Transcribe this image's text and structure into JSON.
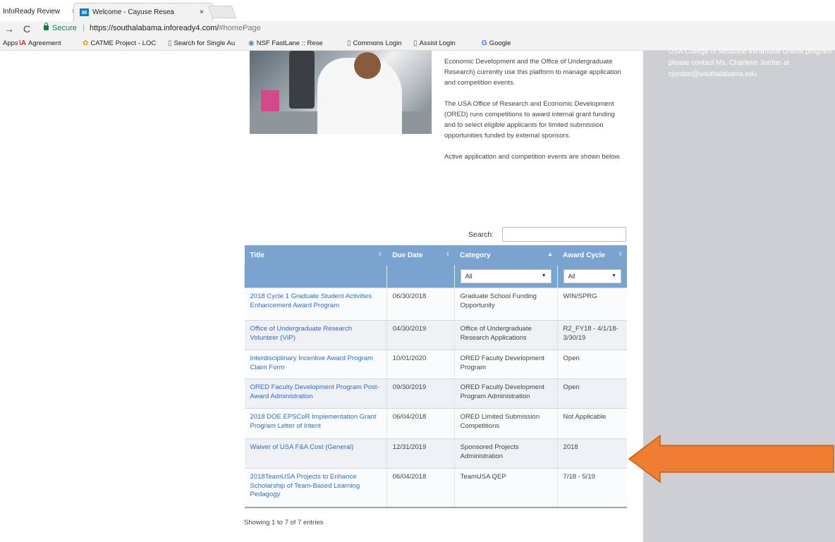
{
  "browser": {
    "tabs": [
      {
        "title": "InfoReady Review",
        "close": "×"
      },
      {
        "title": "Welcome - Cayuse Resea",
        "close": "×"
      }
    ],
    "back": "→",
    "reload": "C",
    "secure_label": "Secure",
    "separator": "|",
    "url": "https://southalabama.infoready4.com/",
    "url_hash": "#homePage",
    "bookmarks": [
      {
        "icon": "·",
        "label": "Apps"
      },
      {
        "icon": "\\A",
        "label": "Agreement"
      },
      {
        "icon": "✿",
        "label": "CATME Project - LOC"
      },
      {
        "icon": "▯",
        "label": "Search for Single Au"
      },
      {
        "icon": "◉",
        "label": "NSF FastLane :: Rese"
      },
      {
        "icon": "▯",
        "label": "Commons Login"
      },
      {
        "icon": "▯",
        "label": "Assist Login"
      },
      {
        "icon": "G",
        "label": "Google"
      }
    ]
  },
  "sidebar": {
    "text": "USA College of Medicine Intramural Grants program please contact Ms. Charlene Jordan at cjordan@southalabama.edu"
  },
  "intro": {
    "p1": "Economic Development and the Office of Undergraduate Research) currently use this platform to manage application and competition events.",
    "p2": "The USA Office of Research and Economic Development (ORED) runs competitions to award internal grant funding and to select eligible applicants for limited submission opportunities funded by external sponsors.",
    "p3": "Active application and competition events are shown below."
  },
  "search": {
    "label": "Search:",
    "value": ""
  },
  "table": {
    "headers": {
      "title": "Title",
      "due_date": "Due Date",
      "category": "Category",
      "award_cycle": "Award Cycle"
    },
    "filters": {
      "category": "All",
      "award_cycle": "All"
    },
    "rows": [
      {
        "title": "2018 Cycle 1 Graduate Student Activities Enhancement Award Program",
        "due": "06/30/2018",
        "category": "Graduate School Funding Opportunity",
        "award": "WIN/SPRG"
      },
      {
        "title": "Office of Undergraduate Research Volunteer (VIP)",
        "due": "04/30/2019",
        "category": "Office of Undergraduate Research Applications",
        "award": "R2_FY18 - 4/1/18-3/30/19"
      },
      {
        "title": "Interdisciplinary Incentive Award Program Claim Form",
        "due": "10/01/2020",
        "category": "ORED Faculty Development Program",
        "award": "Open"
      },
      {
        "title": "ORED Faculty Development Program Post-Award Administration",
        "due": "09/30/2019",
        "category": "ORED Faculty Development Program Administration",
        "award": "Open"
      },
      {
        "title": "2018 DOE EPSCoR Implementation Grant Program Letter of Intent",
        "due": "06/04/2018",
        "category": "ORED Limited Submission Competitions",
        "award": "Not Applicable"
      },
      {
        "title": "Waiver of USA F&A Cost (General)",
        "due": "12/31/2019",
        "category": "Sponsored Projects Administration",
        "award": "2018"
      },
      {
        "title": "2018TeamUSA Projects to Enhance Scholarship of Team-Based Learning Pedagogy",
        "due": "06/04/2018",
        "category": "TeamUSA QEP",
        "award": "7/18 - 5/19"
      }
    ],
    "summary": "Showing 1 to 7 of 7 entries"
  },
  "colors": {
    "header_blue": "#7ba3cf",
    "link_blue": "#2f6fba",
    "sidebar_gray": "#cecfd3",
    "arrow_orange": "#ed7d31"
  }
}
